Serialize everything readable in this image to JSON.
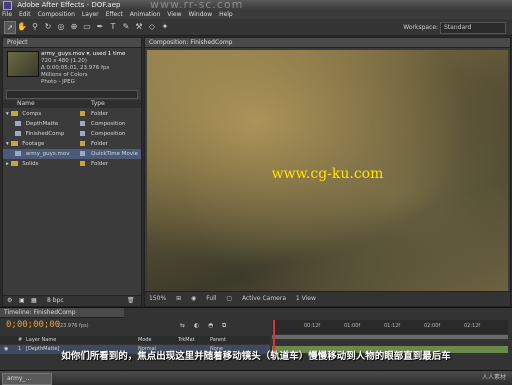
{
  "window": {
    "title": "Adobe After Effects - DOF.aep"
  },
  "menu": [
    "File",
    "Edit",
    "Composition",
    "Layer",
    "Effect",
    "Animation",
    "View",
    "Window",
    "Help"
  ],
  "workspace": {
    "label": "Workspace:",
    "value": "Standard"
  },
  "project": {
    "tab": "Project",
    "selected_item": {
      "name": "army_guys.mov ▾, used 1 time",
      "line1": "720 x 480 (1.20)",
      "line2": "Δ 0;00;05;01, 23.976 fps",
      "line3": "Millions of Colors",
      "line4": "Photo - JPEG"
    },
    "columns": {
      "name": "Name",
      "type": "Type"
    },
    "rows": [
      {
        "name": "Comps",
        "type": "Folder",
        "kind": "folder",
        "tag": "#c9a43e"
      },
      {
        "name": "DepthMatte",
        "type": "Composition",
        "kind": "comp",
        "tag": "#9aa9c8"
      },
      {
        "name": "FinishedComp",
        "type": "Composition",
        "kind": "comp",
        "tag": "#9aa9c8"
      },
      {
        "name": "Footage",
        "type": "Folder",
        "kind": "folder",
        "tag": "#c9a43e"
      },
      {
        "name": "army_guys.mov",
        "type": "QuickTime Movie",
        "kind": "comp",
        "tag": "#9aa9c8"
      },
      {
        "name": "Solids",
        "type": "Folder",
        "kind": "folder",
        "tag": "#c9a43e"
      }
    ],
    "footer": {
      "bpc": "8 bpc"
    }
  },
  "composition": {
    "tab": "Composition: FinishedComp",
    "watermark": "www.cg-ku.com",
    "footer": {
      "zoom": "150%",
      "resolution": "Full",
      "camera": "Active Camera",
      "views": "1 View"
    }
  },
  "timeline": {
    "tab": "Timeline: FinishedComp",
    "timecode": "0;00;00;00",
    "fps": "(23.976 fps)",
    "headers": {
      "layer_name": "Layer Name",
      "mode": "Mode",
      "trkmat": "TrkMat",
      "parent": "Parent"
    },
    "layer": {
      "number": "1",
      "name": "[DepthMatte]",
      "mode": "Normal",
      "parent": "None"
    },
    "ticks": [
      "00:12f",
      "01:00f",
      "01:12f",
      "02:00f",
      "02:12f"
    ]
  },
  "subtitle": "如你们所看到的，焦点出现这里并随着移动镜头（轨道车）慢慢移动到人物的眼部直到最后车",
  "taskbar": {
    "item": "army_..."
  },
  "watermark_top": "www.rr-sc.com",
  "watermark_bottom": "人人素材"
}
